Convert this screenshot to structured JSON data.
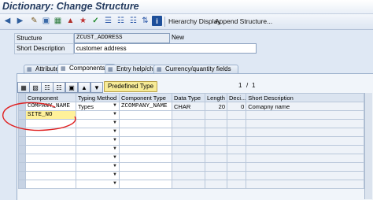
{
  "window": {
    "title": "Dictionary: Change Structure"
  },
  "toolbar": {
    "hierarchy_display": "Hierarchy Display",
    "append_structure": "Append Structure...",
    "icons": [
      "arrow-left-icon",
      "arrow-right-icon",
      "display-change-icon",
      "edit-icon",
      "table-icon",
      "transport-icon",
      "activate-icon",
      "check-icon",
      "object-list-icon",
      "hierarchy-icon",
      "where-used-icon",
      "sort-icon",
      "help-icon"
    ]
  },
  "header": {
    "structure_label": "Structure",
    "structure_value": "ZCUST_ADDRESS",
    "structure_status": "New",
    "short_desc_label": "Short Description",
    "short_desc_value": "customer address"
  },
  "tabs": [
    {
      "label": "Attributes"
    },
    {
      "label": "Components"
    },
    {
      "label": "Entry help/check"
    },
    {
      "label": "Currency/quantity fields"
    }
  ],
  "grid_toolbar": {
    "predefined_type_label": "Predefined Type",
    "page_current": "1",
    "page_sep": "/",
    "page_total": "1"
  },
  "grid": {
    "columns": [
      "Component",
      "Typing Method",
      "Component Type",
      "Data Type",
      "Length",
      "Deci...",
      "Short Description"
    ],
    "rows": [
      {
        "component": "COMPANY_NAME",
        "typing_method": "Types",
        "component_type": "ZCOMPANY_NAME",
        "data_type": "CHAR",
        "length": "20",
        "decimals": "0",
        "short_description": "Comapny name"
      },
      {
        "component": "SITE_NO",
        "typing_method": "",
        "component_type": "",
        "data_type": "",
        "length": "",
        "decimals": "",
        "short_description": ""
      }
    ]
  },
  "colors": {
    "accent": "#233a5e",
    "highlight": "#fff19a",
    "annotation": "#e02020"
  }
}
